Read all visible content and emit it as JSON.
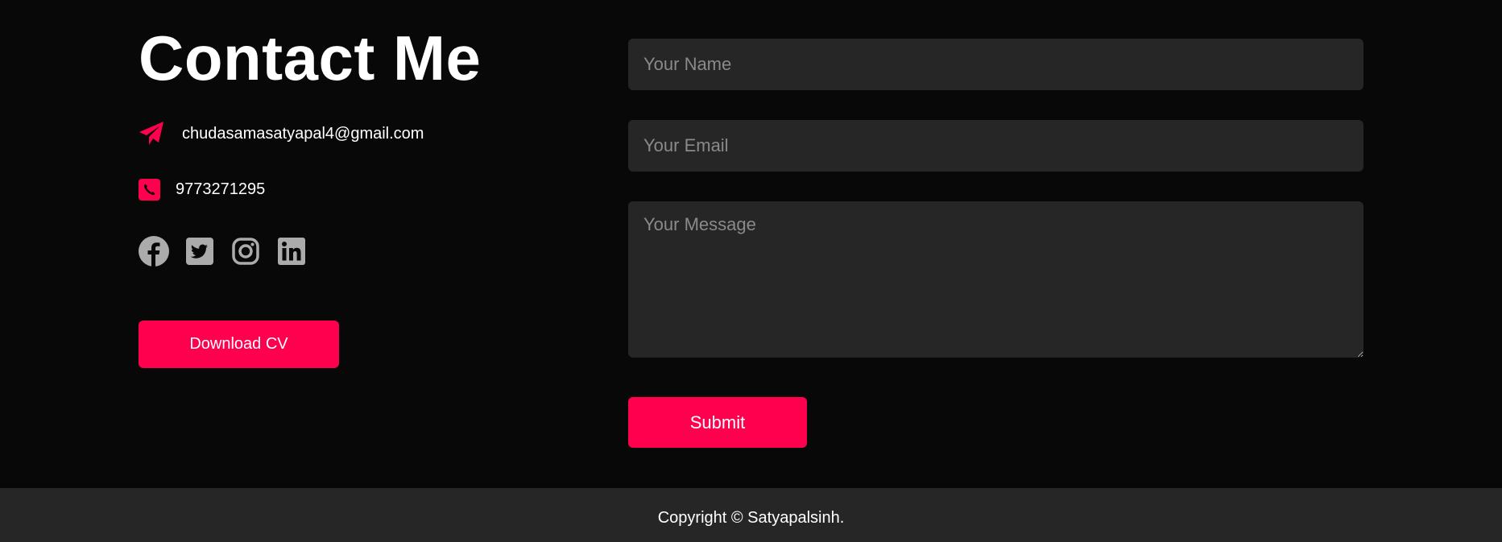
{
  "contact": {
    "title": "Contact Me",
    "email": "chudasamasatyapal4@gmail.com",
    "email_icon": "paper-plane-icon",
    "phone": "9773271295",
    "phone_icon": "phone-square-icon",
    "social_icons": [
      "facebook-icon",
      "twitter-icon",
      "instagram-icon",
      "linkedin-icon"
    ],
    "download_label": "Download CV"
  },
  "form": {
    "name_placeholder": "Your Name",
    "email_placeholder": "Your Email",
    "message_placeholder": "Your Message",
    "submit_label": "Submit"
  },
  "footer": {
    "copyright": "Copyright © Satyapalsinh."
  },
  "colors": {
    "background": "#080808",
    "accent": "#ff004f",
    "field_bg": "#262626",
    "footer_bg": "#262626",
    "social_icon": "#ababab",
    "placeholder": "#8a8a8a"
  }
}
